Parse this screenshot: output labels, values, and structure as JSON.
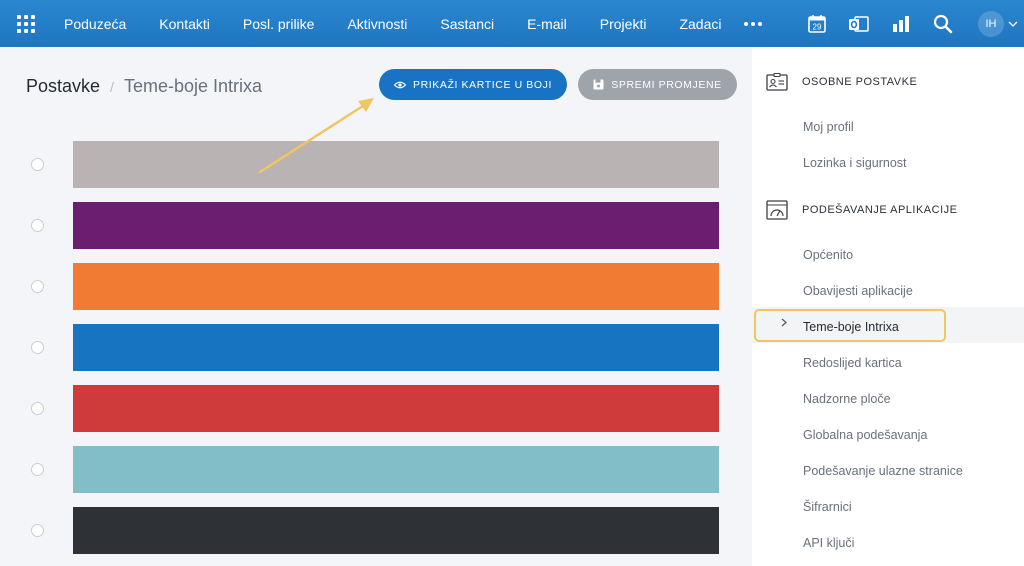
{
  "nav": {
    "items": [
      "Poduzeća",
      "Kontakti",
      "Posl. prilike",
      "Aktivnosti",
      "Sastanci",
      "E-mail",
      "Projekti",
      "Zadaci"
    ],
    "calendar_day": "29",
    "avatar_initials": "IH"
  },
  "breadcrumb": {
    "root": "Postavke",
    "separator": "/",
    "current": "Teme-boje Intrixa"
  },
  "buttons": {
    "show_cards": "PRIKAŽI KARTICE U BOJI",
    "save": "SPREMI PROMJENE"
  },
  "themes": [
    {
      "name": "grey",
      "color": "#b9b3b3"
    },
    {
      "name": "purple",
      "color": "#6d1d6f"
    },
    {
      "name": "orange",
      "color": "#f27b33"
    },
    {
      "name": "blue",
      "color": "#1674c0"
    },
    {
      "name": "red",
      "color": "#cf3b3b"
    },
    {
      "name": "teal",
      "color": "#81bec7"
    },
    {
      "name": "dark",
      "color": "#2e3237"
    }
  ],
  "sidebar": {
    "personal": {
      "title": "OSOBNE POSTAVKE",
      "items": [
        "Moj profil",
        "Lozinka i sigurnost"
      ]
    },
    "app": {
      "title": "PODEŠAVANJE APLIKACIJE",
      "items": [
        "Općenito",
        "Obavijesti aplikacije",
        "Teme-boje Intrixa",
        "Redoslijed kartica",
        "Nadzorne ploče",
        "Globalna podešavanja",
        "Podešavanje ulazne stranice",
        "Šifrarnici",
        "API ključi"
      ]
    }
  },
  "colors": {
    "topbar": "#1f76c0",
    "primary_button": "#1873c4",
    "secondary_button": "#9fa4aa",
    "highlight": "#f0c562"
  }
}
